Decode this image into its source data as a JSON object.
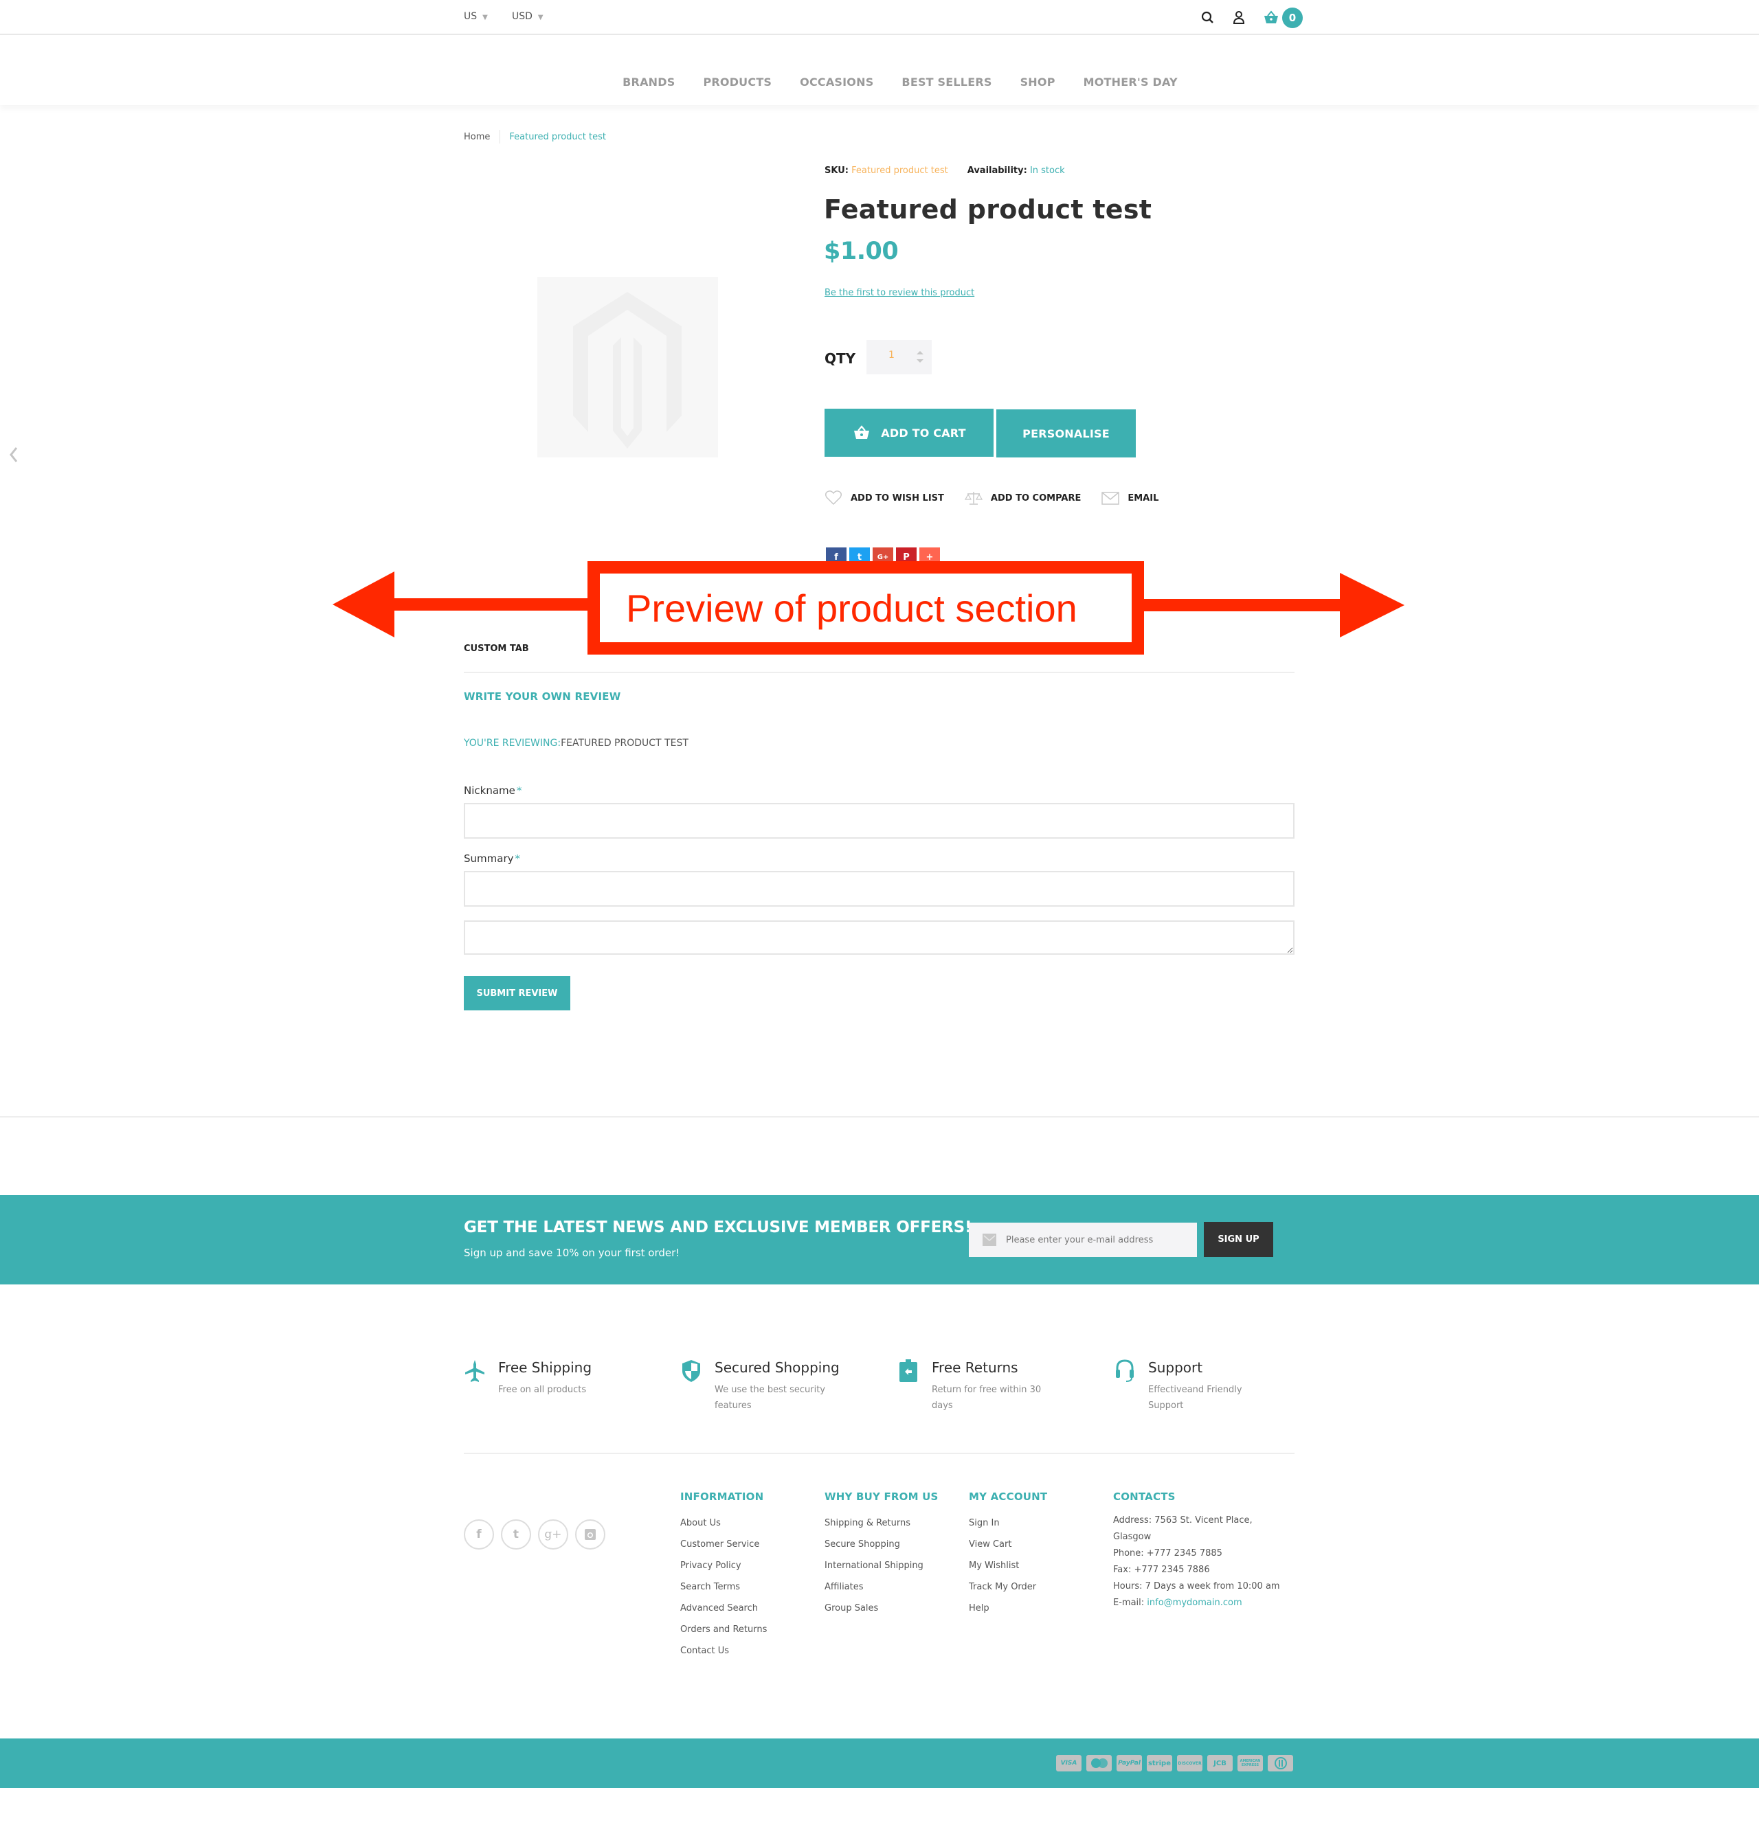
{
  "header": {
    "country": "US",
    "currency": "USD",
    "cart_count": "0",
    "icons": [
      "search-icon",
      "user-icon",
      "cart-icon"
    ]
  },
  "nav": {
    "items": [
      "BRANDS",
      "PRODUCTS",
      "OCCASIONS",
      "BEST SELLERS",
      "SHOP",
      "MOTHER'S DAY"
    ]
  },
  "breadcrumb": {
    "home": "Home",
    "current": "Featured product test"
  },
  "product": {
    "sku_label": "SKU:",
    "sku_value": "Featured product test",
    "availability_label": "Availability:",
    "availability_value": "In stock",
    "title": "Featured product test",
    "price": "$1.00",
    "review_link": "Be the first to review this product",
    "qty_label": "QTY",
    "qty_value": "1",
    "add_to_cart": "ADD TO CART",
    "personalise": "PERSONALISE",
    "actions": [
      "ADD TO WISH LIST",
      "ADD TO COMPARE",
      "EMAIL"
    ],
    "share": [
      {
        "icon": "facebook-icon",
        "glyph": "f",
        "color": "#3b5998"
      },
      {
        "icon": "twitter-icon",
        "glyph": "t",
        "color": "#1da1f2"
      },
      {
        "icon": "google-plus-icon",
        "glyph": "G+",
        "color": "#dd4b39"
      },
      {
        "icon": "pinterest-icon",
        "glyph": "P",
        "color": "#cb2027"
      },
      {
        "icon": "more-share-icon",
        "glyph": "+",
        "color": "#ff6550"
      }
    ]
  },
  "annotation": {
    "text": "Preview of product section",
    "color": "#ff2800"
  },
  "tabs": {
    "custom_tab": "CUSTOM TAB"
  },
  "review_form": {
    "heading": "WRITE YOUR OWN REVIEW",
    "reviewing_label": "YOU'RE REVIEWING:",
    "reviewing_product": "FEATURED PRODUCT TEST",
    "nickname_label": "Nickname",
    "summary_label": "Summary",
    "required_mark": "*",
    "nickname_value": "",
    "summary_value": "",
    "review_value": "",
    "submit": "SUBMIT REVIEW"
  },
  "newsletter": {
    "title": "GET THE LATEST NEWS AND EXCLUSIVE MEMBER OFFERS!",
    "subtitle": "Sign up and save 10% on your first order!",
    "placeholder": "Please enter your e-mail address",
    "button": "SIGN UP"
  },
  "features": [
    {
      "icon": "airplane-icon",
      "title": "Free Shipping",
      "desc": "Free on all products"
    },
    {
      "icon": "shield-icon",
      "title": "Secured Shopping",
      "desc": "We use the best security features"
    },
    {
      "icon": "return-tag-icon",
      "title": "Free Returns",
      "desc": "Return for free within 30 days"
    },
    {
      "icon": "headset-icon",
      "title": "Support",
      "desc": "Effectiveand Friendly Support"
    }
  ],
  "footer": {
    "social": [
      "facebook-icon",
      "twitter-icon",
      "google-plus-icon",
      "instagram-icon"
    ],
    "columns": [
      {
        "title": "INFORMATION",
        "links": [
          "About Us",
          "Customer Service",
          "Privacy Policy",
          "Search Terms",
          "Advanced Search",
          "Orders and Returns",
          "Contact Us"
        ]
      },
      {
        "title": "WHY BUY FROM US",
        "links": [
          "Shipping & Returns",
          "Secure Shopping",
          "International Shipping",
          "Affiliates",
          "Group Sales"
        ]
      },
      {
        "title": "MY ACCOUNT",
        "links": [
          "Sign In",
          "View Cart",
          "My Wishlist",
          "Track My Order",
          "Help"
        ]
      }
    ],
    "contacts": {
      "title": "CONTACTS",
      "address_1": "Address: 7563 St. Vicent Place,",
      "address_2": "Glasgow",
      "phone": "Phone: +777 2345 7885",
      "fax": "Fax: +777 2345 7886",
      "hours": "Hours: 7 Days a week from 10:00 am",
      "email_label": "E-mail: ",
      "email": "info@mydomain.com"
    },
    "payments": [
      "VISA",
      "MasterCard",
      "PayPal",
      "stripe",
      "DISCOVER",
      "JCB",
      "AMERICAN EXPRESS",
      "Diners"
    ]
  },
  "colors": {
    "accent": "#3db0b1",
    "sku": "#f7b35b",
    "dark_button": "#333333"
  }
}
